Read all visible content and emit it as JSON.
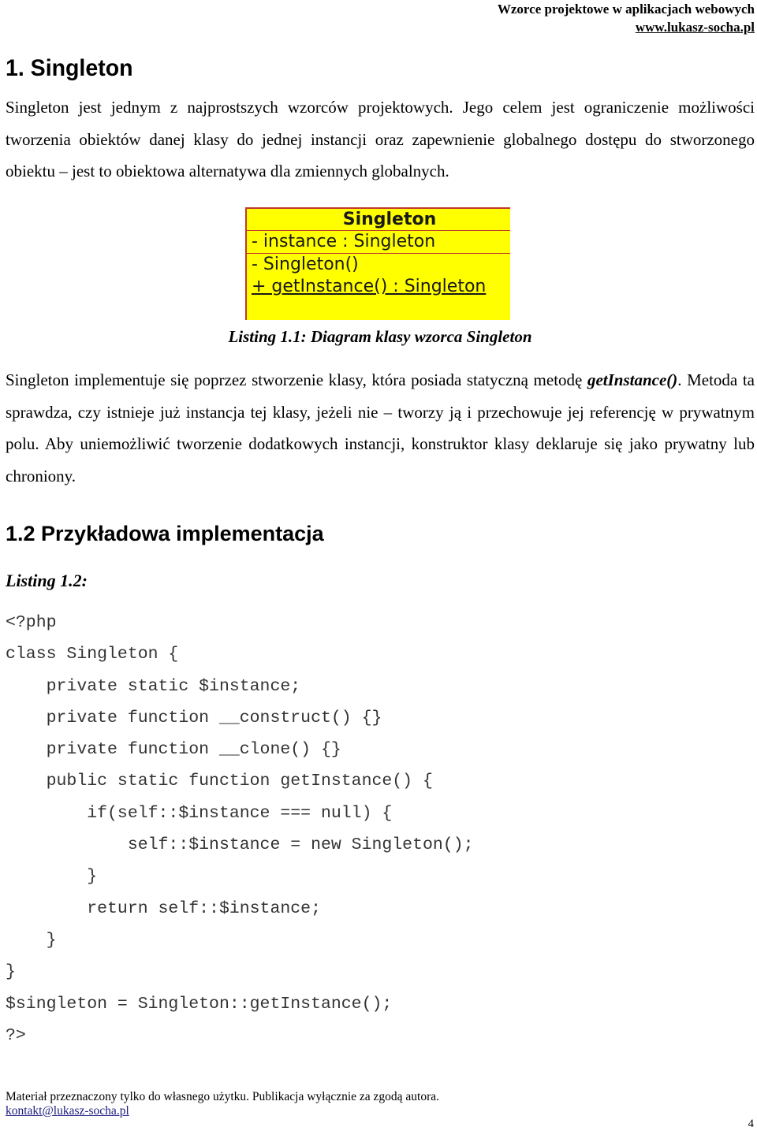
{
  "header": {
    "title": "Wzorce projektowe w aplikacjach webowych",
    "website": "www.lukasz-socha.pl"
  },
  "section1": {
    "heading": "1. Singleton",
    "intro": "Singleton jest jednym  z najprostszych wzorców projektowych. Jego celem jest ograniczenie możliwości tworzenia obiektów danej klasy do jednej instancji oraz zapewnienie globalnego dostępu do stworzonego obiektu – jest to obiektowa alternatywa dla zmiennych globalnych."
  },
  "uml": {
    "class_name": "Singleton",
    "attributes": [
      "- instance : Singleton"
    ],
    "operations": [
      {
        "text": "- Singleton()",
        "static": false
      },
      {
        "text": "+ getInstance() : Singleton",
        "static": true
      }
    ],
    "fill_color": "#ffff00",
    "border_color": "#c0392b"
  },
  "figure_caption": "Listing 1.1: Diagram klasy wzorca Singleton",
  "section1_body": {
    "before": "Singleton implementuje się poprzez stworzenie klasy, która posiada statyczną metodę ",
    "method": "getInstance()",
    "after": ". Metoda ta sprawdza, czy istnieje już instancja tej klasy, jeżeli nie – tworzy ją i przechowuje jej referencję w prywatnym polu. Aby uniemożliwić tworzenie dodatkowych instancji, konstruktor klasy deklaruje się jako prywatny lub chroniony."
  },
  "section2": {
    "heading": "1.2 Przykładowa implementacja",
    "listing_label": "Listing 1.2:",
    "code_lines": [
      "<?php",
      "class Singleton {",
      "    private static $instance;",
      "    private function __construct() {}",
      "    private function __clone() {}",
      "    public static function getInstance() {",
      "        if(self::$instance === null) {",
      "            self::$instance = new Singleton();",
      "        }",
      "        return self::$instance;",
      "    }",
      "}",
      "$singleton = Singleton::getInstance();",
      "?>"
    ]
  },
  "footer": {
    "notice": "Materiał przeznaczony tylko do własnego użytku. Publikacja wyłącznie za zgodą autora.",
    "email": "kontakt@lukasz-socha.pl",
    "page_number": "4"
  }
}
